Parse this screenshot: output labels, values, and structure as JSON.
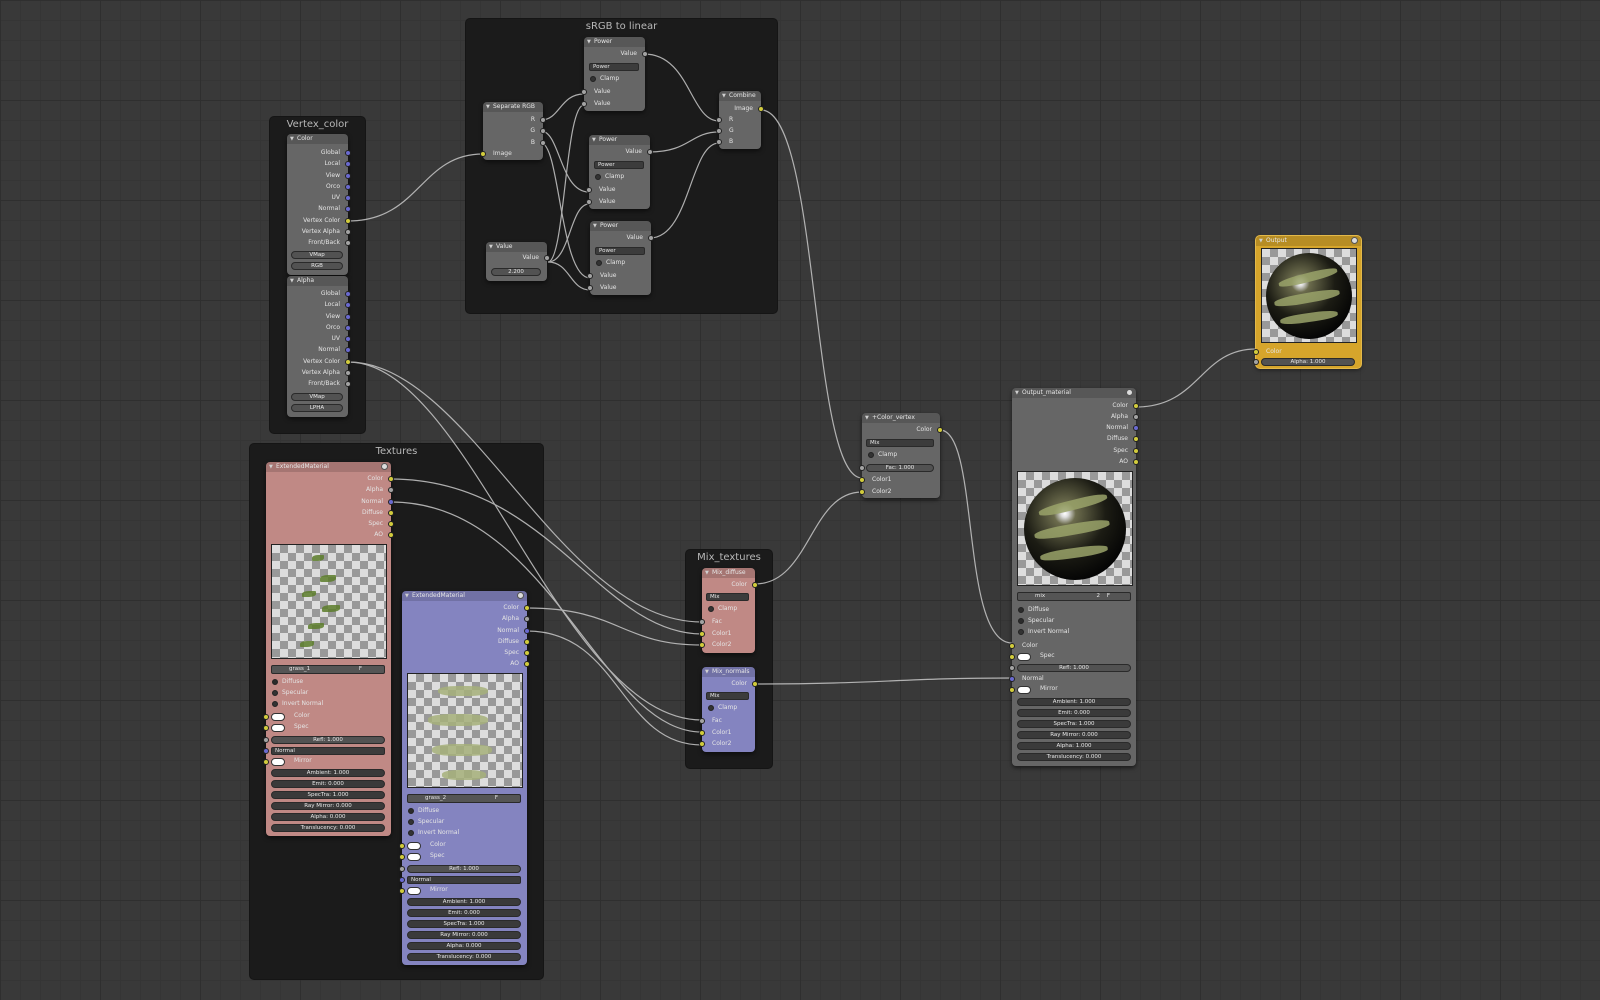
{
  "frames": {
    "srgb": "sRGB to linear",
    "vertex": "Vertex_color",
    "textures": "Textures",
    "mix": "Mix_textures"
  },
  "power_nodes": [
    {
      "title": "Power",
      "output": "Value",
      "op": "Power",
      "clamp": "Clamp",
      "in1": "Value",
      "in2": "Value"
    },
    {
      "title": "Power",
      "output": "Value",
      "op": "Power",
      "clamp": "Clamp",
      "in1": "Value",
      "in2": "Value"
    },
    {
      "title": "Power",
      "output": "Value",
      "op": "Power",
      "clamp": "Clamp",
      "in1": "Value",
      "in2": "Value"
    }
  ],
  "separate_rgb": {
    "title": "Separate RGB",
    "outputs": [
      "R",
      "G",
      "B"
    ],
    "input": "Image"
  },
  "value_node": {
    "title": "Value",
    "output": "Value",
    "field": "2.200"
  },
  "combine": {
    "title": "Combine",
    "output": "Image",
    "inputs": [
      "R",
      "G",
      "B"
    ]
  },
  "color_node": {
    "title": "Color",
    "outputs": [
      "Global",
      "Local",
      "View",
      "Orco",
      "UV",
      "Normal",
      "Vertex Color",
      "Vertex Alpha",
      "Front/Back"
    ],
    "fields": [
      "VMap",
      "RGB"
    ]
  },
  "alpha_node": {
    "title": "Alpha",
    "outputs": [
      "Global",
      "Local",
      "View",
      "Orco",
      "UV",
      "Normal",
      "Vertex Color",
      "Vertex Alpha",
      "Front/Back"
    ],
    "fields": [
      "VMap",
      "LPHA"
    ]
  },
  "material_nodes": [
    {
      "title": "ExtendedMaterial",
      "outputs": [
        "Color",
        "Alpha",
        "Normal",
        "Diffuse",
        "Spec",
        "AO"
      ],
      "datablock": "grass_1",
      "flag": "F",
      "checks": [
        "Diffuse",
        "Specular",
        "Invert Normal"
      ],
      "color_label": "Color",
      "spec_label": "Spec",
      "refl": "Refl: 1.000",
      "normal_select": "Normal",
      "mirror": "Mirror",
      "fields": [
        "Ambient: 1.000",
        "Emit: 0.000",
        "SpecTra: 1.000",
        "Ray Mirror: 0.000",
        "Alpha: 0.000",
        "Translucency: 0.000"
      ]
    },
    {
      "title": "ExtendedMaterial",
      "outputs": [
        "Color",
        "Alpha",
        "Normal",
        "Diffuse",
        "Spec",
        "AO"
      ],
      "datablock": "grass_2",
      "flag": "F",
      "checks": [
        "Diffuse",
        "Specular",
        "Invert Normal"
      ],
      "color_label": "Color",
      "spec_label": "Spec",
      "refl": "Refl: 1.000",
      "normal_select": "Normal",
      "mirror": "Mirror",
      "fields": [
        "Ambient: 1.000",
        "Emit: 0.000",
        "SpecTra: 1.000",
        "Ray Mirror: 0.000",
        "Alpha: 0.000",
        "Translucency: 0.000"
      ]
    }
  ],
  "mix_nodes": [
    {
      "title": "Mix_diffuse",
      "output": "Color",
      "blend": "Mix",
      "clamp": "Clamp",
      "inputs": [
        "Fac",
        "Color1",
        "Color2"
      ]
    },
    {
      "title": "Mix_normals",
      "output": "Color",
      "blend": "Mix",
      "clamp": "Clamp",
      "inputs": [
        "Fac",
        "Color1",
        "Color2"
      ]
    }
  ],
  "color_vertex": {
    "title": "+Color_vertex",
    "output": "Color",
    "blend": "Mix",
    "clamp": "Clamp",
    "fac": "Fac: 1.000",
    "inputs": [
      "Color1",
      "Color2"
    ]
  },
  "output_material": {
    "title": "Output_material",
    "outputs": [
      "Color",
      "Alpha",
      "Normal",
      "Diffuse",
      "Spec",
      "AO"
    ],
    "datablock": "mix",
    "users": "2",
    "flag": "F",
    "checks": [
      "Diffuse",
      "Specular",
      "Invert Normal"
    ],
    "color_label": "Color",
    "spec_label": "Spec",
    "refl": "Refl: 1.000",
    "normal_label": "Normal",
    "mirror": "Mirror",
    "fields": [
      "Ambient: 1.000",
      "Emit: 0.000",
      "SpecTra: 1.000",
      "Ray Mirror: 0.000",
      "Alpha: 1.000",
      "Translucency: 0.000"
    ]
  },
  "output": {
    "title": "Output",
    "color": "Color",
    "alpha": "Alpha: 1.000"
  },
  "colors": {
    "background": "#393939",
    "frame": "#1b1b1b",
    "node": "#666666",
    "material_1": "#c08985",
    "material_2": "#8484c0",
    "output": "#d6a52b",
    "wire": "#c8c8c8",
    "socket_color": "#d2cc3c",
    "socket_value": "#a3a3a3",
    "socket_vector": "#6a6ad0"
  }
}
